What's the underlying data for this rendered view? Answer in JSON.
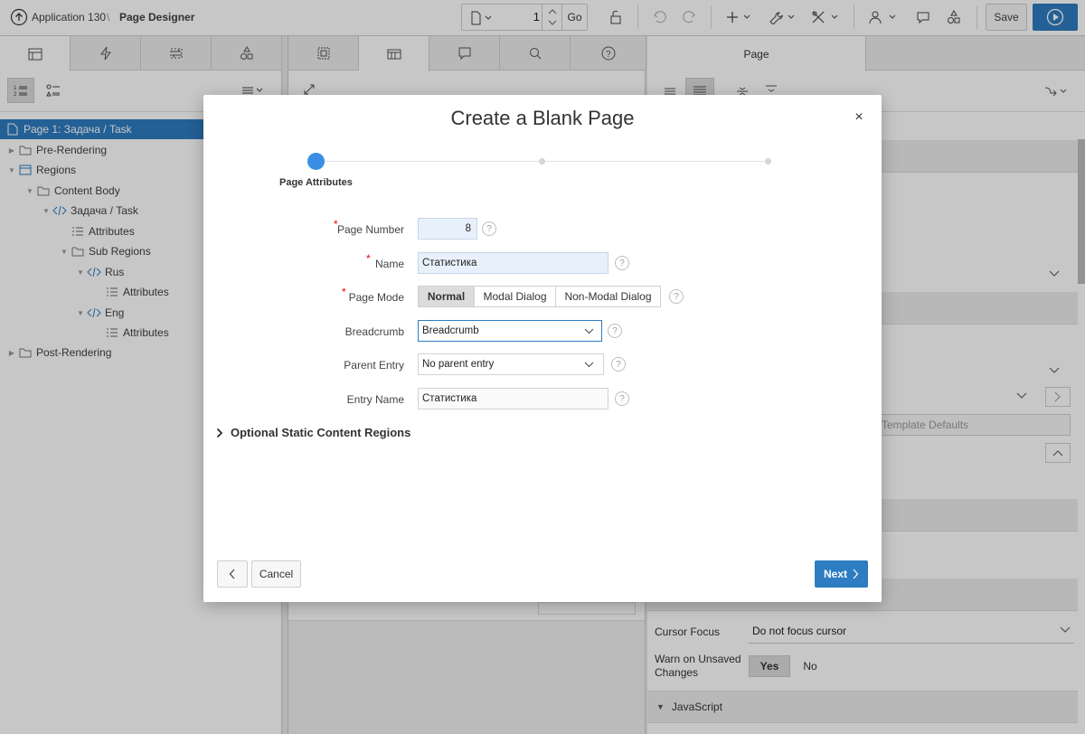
{
  "header": {
    "app_label": "Application 130",
    "separator": "\\",
    "page_designer": "Page Designer",
    "page_number": "1",
    "go_label": "Go",
    "save_label": "Save"
  },
  "left_pane": {
    "tree": [
      {
        "label": "Page 1: Задача / Task",
        "icon": "page-icon"
      },
      {
        "label": "Pre-Rendering",
        "icon": "folder-icon"
      },
      {
        "label": "Regions",
        "icon": "region-icon"
      },
      {
        "label": "Content Body",
        "icon": "folder-icon"
      },
      {
        "label": "Задача / Task",
        "icon": "code-icon"
      },
      {
        "label": "Attributes",
        "icon": "attributes-icon"
      },
      {
        "label": "Sub Regions",
        "icon": "folder-icon"
      },
      {
        "label": "Rus",
        "icon": "code-icon"
      },
      {
        "label": "Attributes",
        "icon": "attributes-icon"
      },
      {
        "label": "Eng",
        "icon": "code-icon"
      },
      {
        "label": "Attributes",
        "icon": "attributes-icon"
      },
      {
        "label": "Post-Rendering",
        "icon": "folder-icon"
      }
    ]
  },
  "right_pane": {
    "tab_label": "Page",
    "template_defaults": "Template Defaults",
    "cursor_focus_label": "Cursor Focus",
    "cursor_focus_value": "Do not focus cursor",
    "warn_label_line1": "Warn on Unsaved",
    "warn_label_line2": "Changes",
    "warn_yes": "Yes",
    "warn_no": "No",
    "javascript_label": "JavaScript"
  },
  "dialog": {
    "title": "Create a Blank Page",
    "close": "×",
    "step_label": "Page Attributes",
    "required_mark": "*",
    "help_mark": "?",
    "fields": {
      "page_number_label": "Page Number",
      "page_number_value": "8",
      "name_label": "Name",
      "name_value": "Статистика",
      "page_mode_label": "Page Mode",
      "page_mode_options": [
        "Normal",
        "Modal Dialog",
        "Non-Modal Dialog"
      ],
      "breadcrumb_label": "Breadcrumb",
      "breadcrumb_value": "Breadcrumb",
      "parent_entry_label": "Parent Entry",
      "parent_entry_value": "No parent entry",
      "entry_name_label": "Entry Name",
      "entry_name_value": "Статистика"
    },
    "optional_regions_label": "Optional Static Content Regions",
    "cancel_label": "Cancel",
    "next_label": "Next",
    "accent": "#2e7cc1",
    "step_color": "#3a8ee6"
  }
}
